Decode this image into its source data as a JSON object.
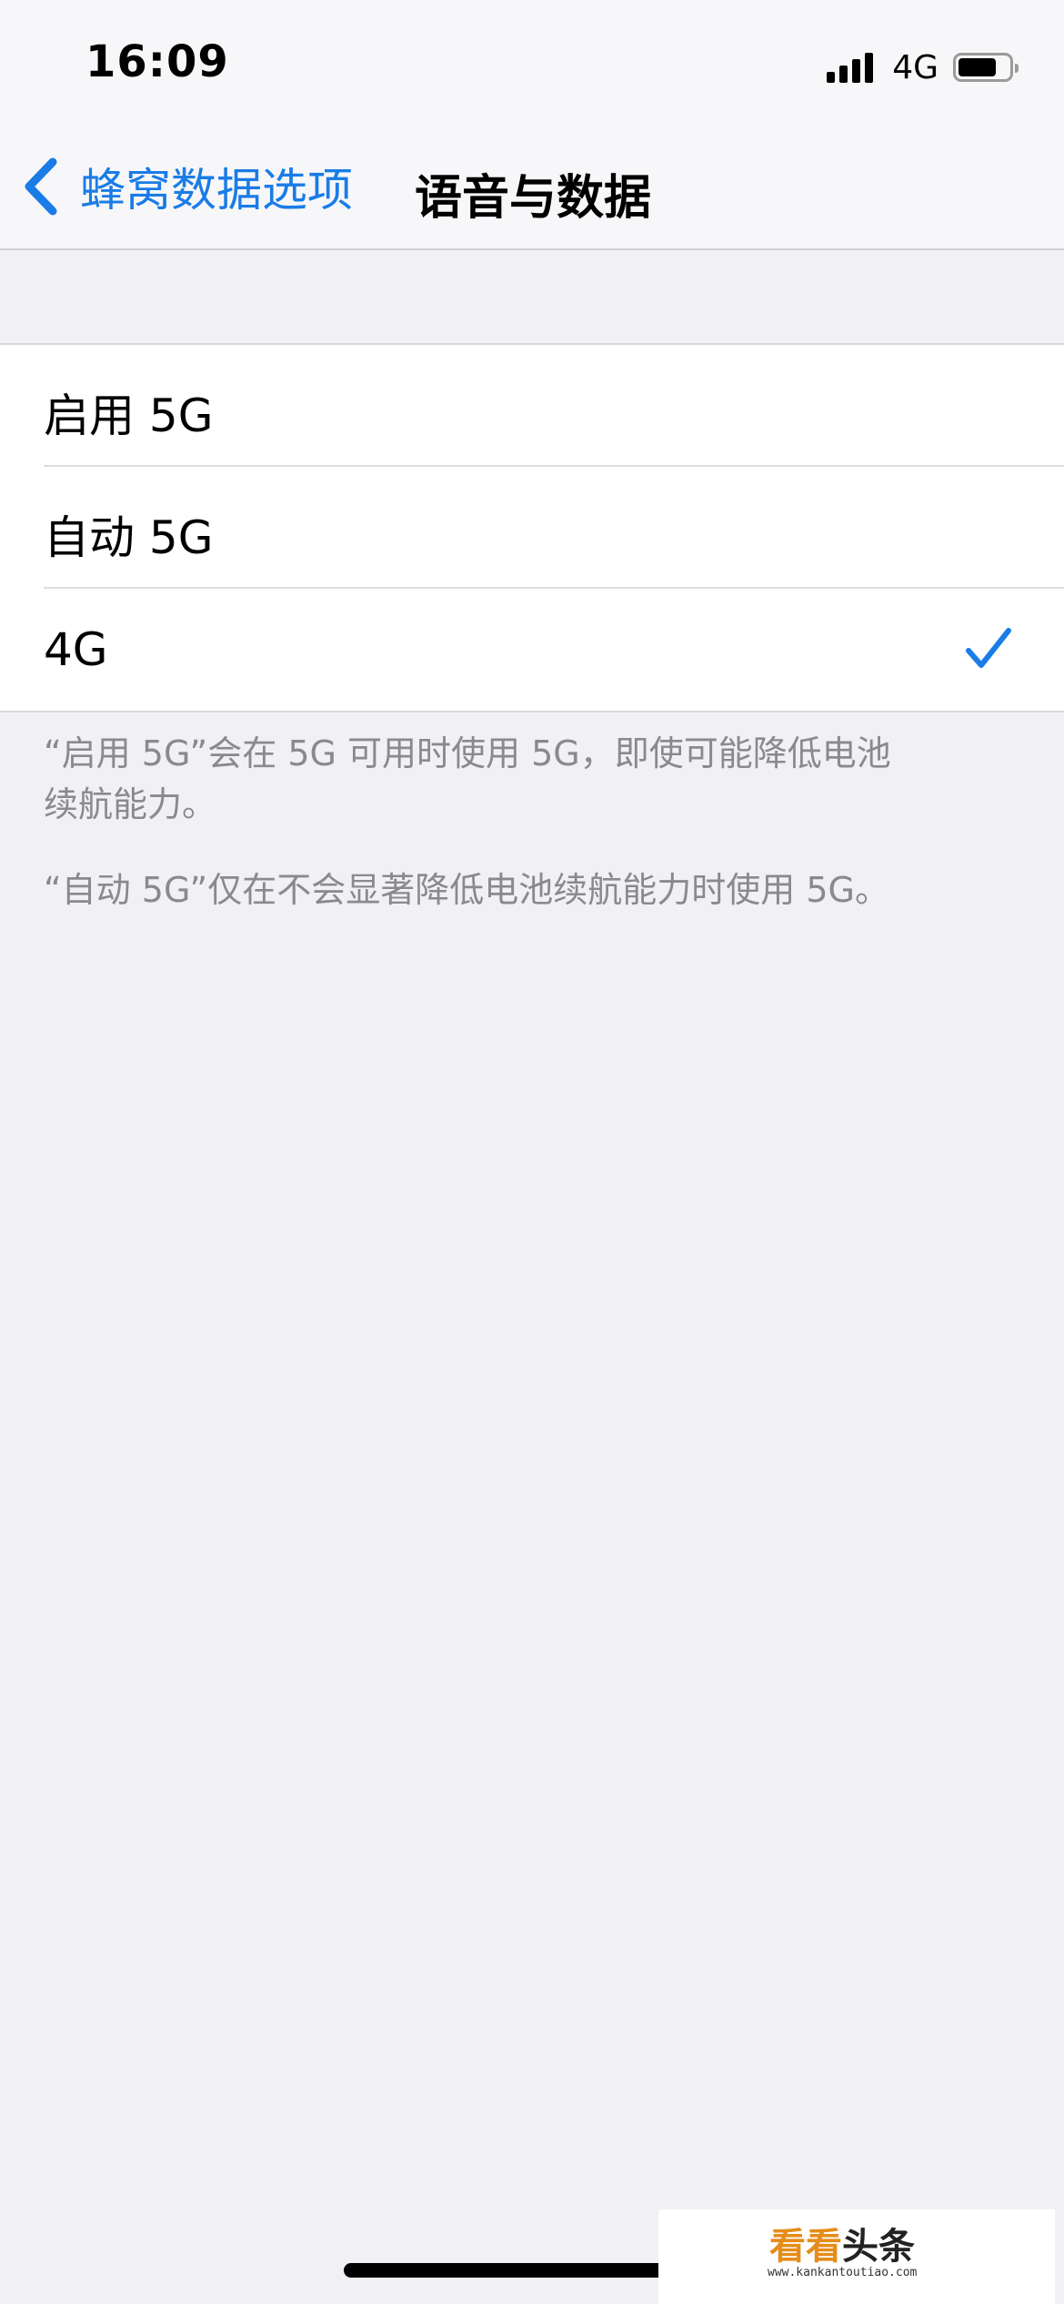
{
  "status_bar": {
    "time": "16:09",
    "network": "4G",
    "signal_bars": 4,
    "battery_level": 0.75
  },
  "nav": {
    "back_label": "蜂窝数据选项",
    "title": "语音与数据"
  },
  "options": [
    {
      "label": "启用 5G",
      "selected": false
    },
    {
      "label": "自动 5G",
      "selected": false
    },
    {
      "label": "4G",
      "selected": true
    }
  ],
  "footer": {
    "note_1": "“启用 5G”会在 5G 可用时使用 5G，即使可能降低电池\n续航能力。",
    "note_2": "“自动 5G”仅在不会显著降低电池续航能力时使用 5G。"
  },
  "watermark": {
    "logo_part_1": "看看",
    "logo_part_2": "头条",
    "url": "www.kankantoutiao.com"
  },
  "colors": {
    "accent": "#1A7CE6",
    "background": "#F1F1F5",
    "footer_text": "#8A8A8E"
  },
  "icons": {
    "back": "chevron-left-icon",
    "selected": "checkmark-icon",
    "signal": "signal-icon",
    "battery": "battery-icon"
  }
}
